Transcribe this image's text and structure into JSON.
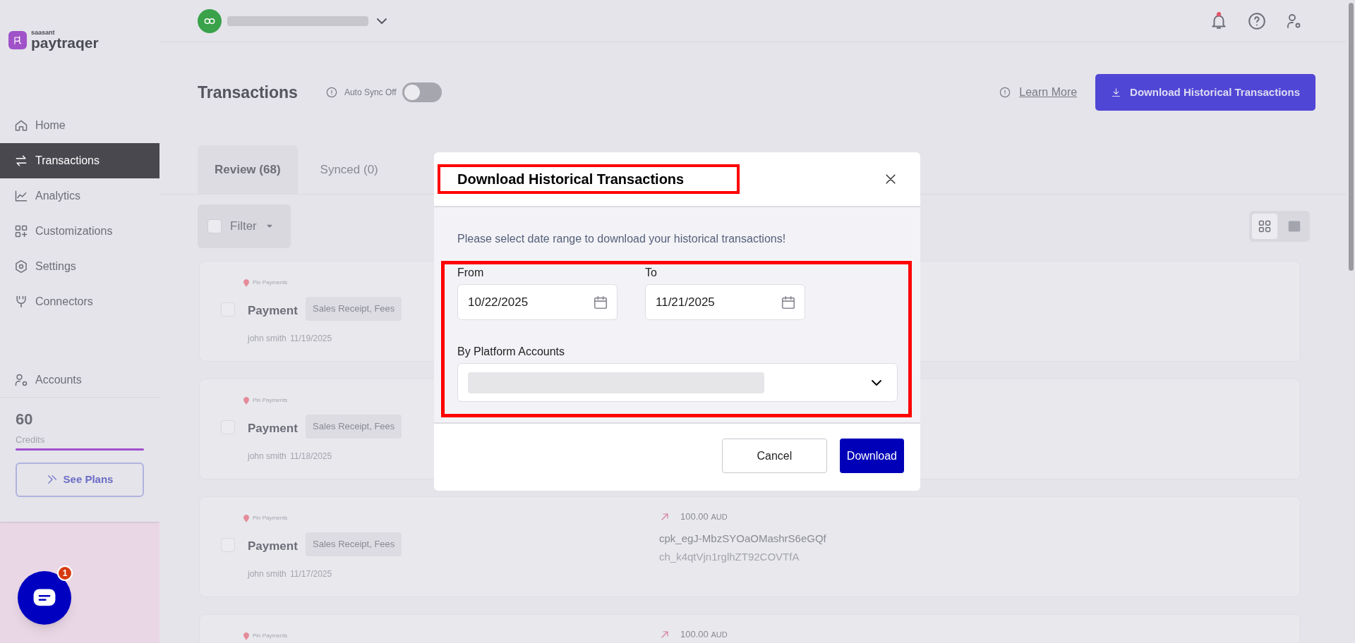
{
  "sidebar": {
    "logo": {
      "brand_small": "saasant",
      "brand": "paytraqer"
    },
    "items": [
      {
        "label": "Home",
        "selected": false
      },
      {
        "label": "Transactions",
        "selected": true
      },
      {
        "label": "Analytics",
        "selected": false
      },
      {
        "label": "Customizations",
        "selected": false
      },
      {
        "label": "Settings",
        "selected": false
      },
      {
        "label": "Connectors",
        "selected": false
      }
    ],
    "accounts": {
      "label": "Accounts"
    },
    "credits": {
      "value": "60",
      "label": "Credits",
      "level": 1
    },
    "see_plans": "See Plans"
  },
  "chat": {
    "badge": "1"
  },
  "page": {
    "title": "Transactions",
    "auto_sync": {
      "label": "Auto Sync Off",
      "on": false
    },
    "learn_more": "Learn More",
    "download_button": "Download Historical Transactions",
    "tabs": [
      {
        "label": "Review (68)",
        "selected": true
      },
      {
        "label": "Synced (0)",
        "selected": false
      }
    ],
    "filter": "Filter",
    "views": [
      {
        "kind": "grid",
        "selected": true
      },
      {
        "kind": "list",
        "selected": false
      }
    ],
    "cards": [
      {
        "source": "Pin Payments",
        "checked": false,
        "title": "Payment",
        "tag": "Sales Receipt, Fees",
        "user": "john smith",
        "date": "11/19/2025"
      },
      {
        "source": "Pin Payments",
        "checked": false,
        "title": "Payment",
        "tag": "Sales Receipt, Fees",
        "user": "john smith",
        "date": "11/18/2025"
      },
      {
        "source": "Pin Payments",
        "checked": false,
        "title": "Payment",
        "tag": "Sales Receipt, Fees",
        "user": "john smith",
        "date": "11/17/2025",
        "amount": "100.00",
        "currency": "AUD",
        "ids": [
          "cpk_egJ-MbzSYOaOMashrS6eGQf",
          "ch_k4qtVjn1rglhZT92COVTfA"
        ]
      },
      {
        "source": "Pin Payments",
        "amount": "100.00",
        "currency": "AUD"
      }
    ]
  },
  "dialog": {
    "title": "Download Historical Transactions",
    "description": "Please select date range to download your historical transactions!",
    "from": {
      "label": "From",
      "value": "10/22/2025"
    },
    "to": {
      "label": "To",
      "value": "11/21/2025"
    },
    "accounts_label": "By Platform Accounts",
    "buttons": [
      {
        "label": "Cancel",
        "kind": "secondary"
      },
      {
        "label": "Download",
        "kind": "primary"
      }
    ]
  }
}
